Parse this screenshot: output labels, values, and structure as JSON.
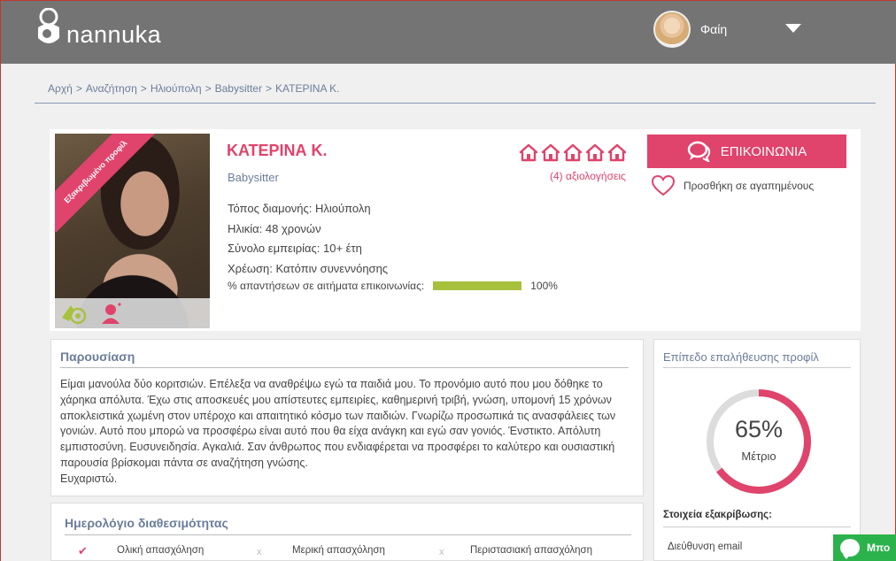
{
  "header": {
    "logo_text": "nannuka",
    "user_name": "Φαίη"
  },
  "breadcrumb": [
    "Αρχή",
    "Αναζήτηση",
    "Ηλιούπολη",
    "Babysitter",
    "ΚΑΤΕΡΙΝΑ Κ."
  ],
  "profile": {
    "verified_ribbon": "Εξακριβωμένο προφίλ",
    "name": "ΚΑΤΕΡΙΝΑ Κ.",
    "role": "Babysitter",
    "rating_houses": 5,
    "reviews": "(4) αξιολογήσεις",
    "details": [
      "Τόπος διαμονής: Ηλιούπολη",
      "Ηλικία: 48 χρονών",
      "Σύνολο εμπειρίας: 10+ έτη",
      "Χρέωση: Κατόπιν συνεννόησης"
    ],
    "response_label": "% απαντήσεων σε αιτήματα επικοινωνίας:",
    "response_value": "100%",
    "response_fraction": 1.0,
    "contact_button": "ΕΠΙΚΟΙΝΩΝΙΑ",
    "favorite_label": "Προσθήκη σε αγαπημένους"
  },
  "presentation": {
    "title": "Παρουσίαση",
    "text": "Είμαι μανούλα δύο κοριτσιών. Επέλεξα να αναθρέψω εγώ τα παιδιά μου. Το προνόμιο αυτό που μου δόθηκε το χάρηκα απόλυτα. Έχω στις αποσκευές μου απίστευτες εμπειρίες, καθημερινή τριβή, γνώση, υπομονή 15 χρόνων αποκλειστικά χωμένη στον υπέροχο και απαιτητικό κόσμο των παιδιών. Γνωρίζω προσωπικά τις ανασφάλειες των γονιών. Αυτό που μπορώ να προσφέρω είναι αυτό που θα είχα ανάγκη και εγώ σαν γονιός. Ένστικτο. Απόλυτη εμπιστοσύνη. Ευσυνειδησία. Αγκαλιά. Σαν άνθρωπος που ενδιαφέρεται να προσφέρει το καλύτερο και ουσιαστική παρουσία βρίσκομαι πάντα σε αναζήτηση γνώσης.",
    "closing": "Ευχαριστώ."
  },
  "verification": {
    "title": "Επίπεδο επαλήθευσης προφίλ",
    "percent_label": "65%",
    "percent": 0.65,
    "level": "Μέτριο",
    "details_title": "Στοιχεία εξακρίβωσης:",
    "first_item": "Διεύθυνση email"
  },
  "availability": {
    "title": "Ημερολόγιο διαθεσιμότητας",
    "items": [
      {
        "label": "Ολική απασχόληση",
        "mark": "✔"
      },
      {
        "label": "Μερική απασχόληση",
        "mark": "x"
      },
      {
        "label": "Περιστασιακή απασχόληση",
        "mark": "x"
      }
    ]
  },
  "chat": {
    "label": "Μπο"
  },
  "colors": {
    "accent": "#e0436b",
    "header": "#747474",
    "link": "#6b7d9a",
    "bar": "#a7c13d",
    "chat": "#2bb24c"
  }
}
